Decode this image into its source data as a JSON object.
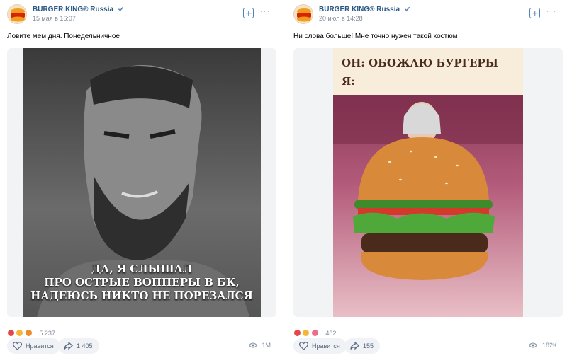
{
  "posts": [
    {
      "author": "BURGER KING® Russia",
      "date": "15 мая в 16:07",
      "text": "Ловите мем дня. Понедельничное",
      "image_caption": [
        "ДА, Я СЛЫШАЛ",
        "ПРО ОСТРЫЕ ВОППЕРЫ В БК,",
        "НАДЕЮСЬ НИКТО НЕ ПОРЕЗАЛСЯ"
      ],
      "reactions_count": "5 237",
      "like_label": "Нравится",
      "share_count": "1 405",
      "views": "1M"
    },
    {
      "author": "BURGER KING® Russia",
      "date": "20 июл в 14:28",
      "text": "Ни слова больше! Мне точно нужен такой костюм",
      "image_caption": [
        "ОН: ОБОЖАЮ БУРГЕРЫ",
        "Я:"
      ],
      "reactions_count": "482",
      "like_label": "Нравится",
      "share_count": "155",
      "views": "182K"
    }
  ],
  "brand": {
    "logo_text": "BURGER KING",
    "accent": "#2a5885",
    "button_bg": "#f0f2f5"
  }
}
